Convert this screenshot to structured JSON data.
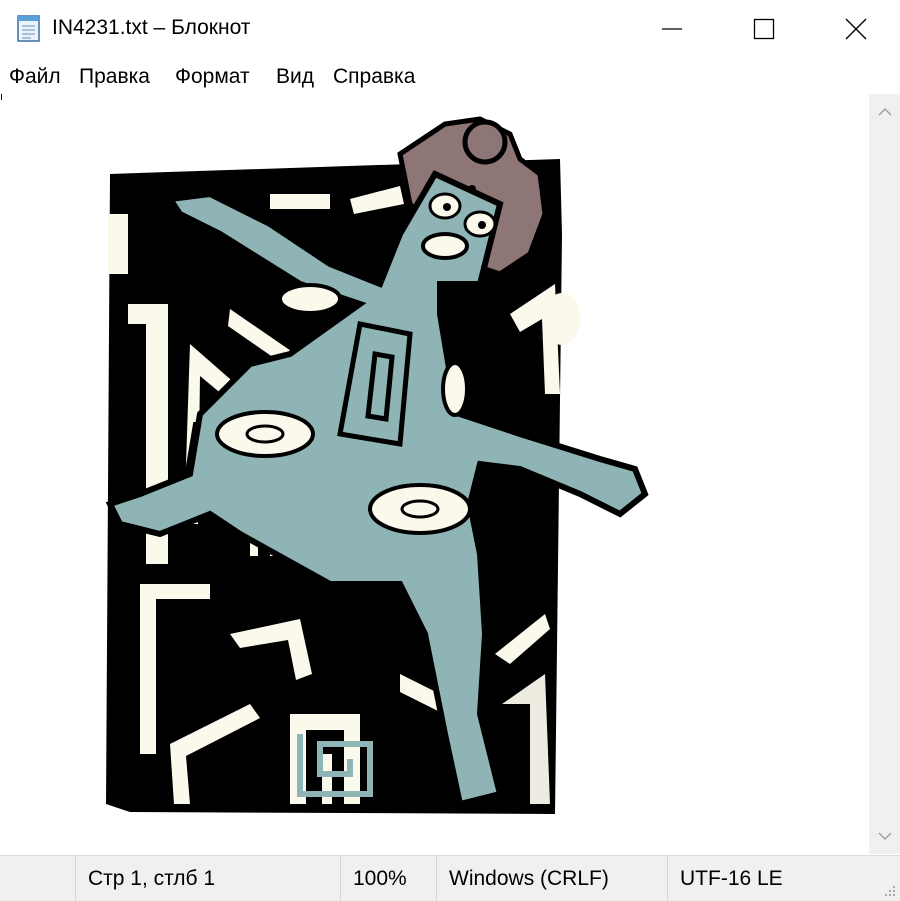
{
  "window": {
    "title": "IN4231.txt – Блокнот",
    "app_icon": "notepad-icon",
    "controls": {
      "minimize_icon": "minimize-icon",
      "maximize_icon": "maximize-icon",
      "close_icon": "close-icon"
    }
  },
  "menu": {
    "items": [
      {
        "label": "Файл"
      },
      {
        "label": "Правка"
      },
      {
        "label": "Формат"
      },
      {
        "label": "Вид"
      },
      {
        "label": "Справка"
      }
    ]
  },
  "status": {
    "position": "Стр 1, стлб 1",
    "zoom": "100%",
    "line_endings": "Windows (CRLF)",
    "encoding": "UTF-16 LE"
  },
  "colors": {
    "figure_fill": "#8fb4b6",
    "accent_brown": "#8f7676",
    "ink": "#000000",
    "cream": "#fbf8ec",
    "chrome_bg": "#f0f0f0"
  }
}
